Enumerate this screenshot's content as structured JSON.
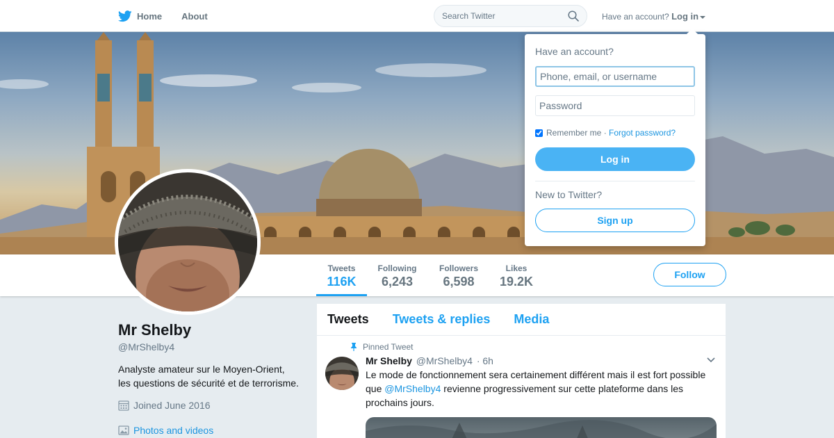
{
  "nav": {
    "home": "Home",
    "about": "About",
    "search_placeholder": "Search Twitter",
    "have_account": "Have an account?",
    "login": "Log in"
  },
  "colors": {
    "accent": "#1da1f2",
    "login_button": "#4ab3f4",
    "link": "#1b95e0"
  },
  "icons": {
    "brand": "twitter-bird-icon",
    "search": "search-icon",
    "calendar": "calendar-icon",
    "photos": "image-icon",
    "pin": "pin-icon",
    "caret": "chevron-down-icon"
  },
  "profile": {
    "name": "Mr Shelby",
    "handle": "@MrShelby4",
    "bio_lines": [
      "Analyste amateur sur le Moyen-Orient,",
      "les questions de sécurité et de terrorisme."
    ],
    "joined": "Joined June 2016",
    "photos_link": "Photos and videos"
  },
  "stats": [
    {
      "label": "Tweets",
      "value": "116K"
    },
    {
      "label": "Following",
      "value": "6,243"
    },
    {
      "label": "Followers",
      "value": "6,598"
    },
    {
      "label": "Likes",
      "value": "19.2K"
    }
  ],
  "follow_button": "Follow",
  "timeline": {
    "tabs": [
      "Tweets",
      "Tweets & replies",
      "Media"
    ],
    "active_tab": "Tweets",
    "pinned_label": "Pinned Tweet",
    "tweet": {
      "name": "Mr Shelby",
      "handle": "@MrShelby4",
      "time": "· 6h",
      "line1": "Le mode de fonctionnement sera certainement différent mais il est fort possible",
      "line2_prefix": "que ",
      "line2_mention": "@MrShelby4",
      "line2_suffix": " revienne progressivement sur cette plateforme dans les",
      "line3": "prochains jours."
    }
  },
  "login_dropdown": {
    "title": "Have an account?",
    "username_placeholder": "Phone, email, or username",
    "password_placeholder": "Password",
    "remember_me": "Remember me",
    "separator": " · ",
    "forgot_password": "Forgot password?",
    "login_button": "Log in",
    "new_to_twitter": "New to Twitter?",
    "signup_button": "Sign up"
  }
}
